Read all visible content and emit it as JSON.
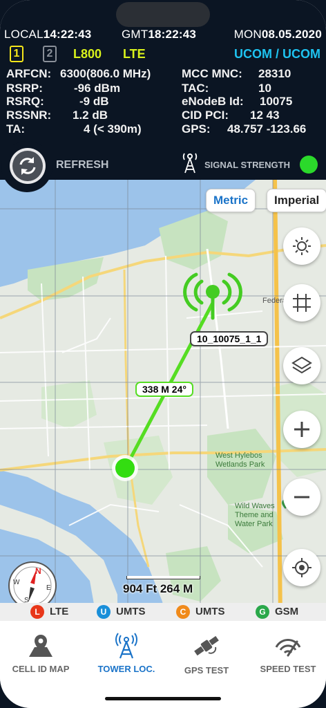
{
  "header": {
    "local_label": "LOCAL",
    "local_time": "14:22:43",
    "gmt_label": "GMT",
    "gmt_time": "18:22:43",
    "day": "MON",
    "date": "08.05.2020",
    "sim1": "1",
    "sim2": "2",
    "band": "L800",
    "tech": "LTE",
    "operator": "UCOM / UCOM",
    "fields_left": [
      {
        "label": "ARFCN:",
        "value": "6300(806.0 MHz)"
      },
      {
        "label": "RSRP:",
        "value": "-96 dBm"
      },
      {
        "label": "RSRQ:",
        "value": "-9 dB"
      },
      {
        "label": "RSSNR:",
        "value": "1.2 dB"
      },
      {
        "label": "TA:",
        "value": "4 (< 390m)"
      }
    ],
    "fields_right": [
      {
        "label": "MCC MNC:",
        "value": "28310"
      },
      {
        "label": "TAC:",
        "value": "10"
      },
      {
        "label": "eNodeB Id:",
        "value": "10075"
      },
      {
        "label": "CID PCI:",
        "value": "12 43"
      },
      {
        "label": "GPS:",
        "value": "48.757 -123.66"
      }
    ],
    "refresh_label": "REFRESH",
    "signal_label": "SIGNAL STRENGTH",
    "signal_color": "#2bd92b"
  },
  "map": {
    "units": {
      "metric": "Metric",
      "imperial": "Imperial",
      "selected": "Metric"
    },
    "tower_label": "10_10075_1_1",
    "distance_label": "338 M 24°",
    "scale_label": "904 Ft 264 M",
    "place_labels": {
      "wetlands": "West Hylebos Wetlands Park",
      "waves": "Wild Waves Theme and Water Park",
      "federal": "Federa"
    },
    "compass_letters": {
      "n": "N",
      "e": "E",
      "s": "S",
      "w": "W"
    }
  },
  "legend": [
    {
      "letter": "L",
      "label": "LTE",
      "color": "#e8371a"
    },
    {
      "letter": "U",
      "label": "UMTS",
      "color": "#1a8fd9"
    },
    {
      "letter": "C",
      "label": "UMTS",
      "color": "#f08a1a"
    },
    {
      "letter": "G",
      "label": "GSM",
      "color": "#2aa84a"
    }
  ],
  "tabs": [
    {
      "label": "CELL ID MAP",
      "icon": "map-pin-icon"
    },
    {
      "label": "TOWER LOC.",
      "icon": "tower-icon",
      "active": true
    },
    {
      "label": "GPS TEST",
      "icon": "satellite-icon"
    },
    {
      "label": "SPEED TEST",
      "icon": "speedometer-icon"
    }
  ],
  "colors": {
    "accent": "#1a73c8",
    "band": "#d9f21b",
    "operator": "#1ec3f0",
    "signal_line": "#55dd22"
  }
}
